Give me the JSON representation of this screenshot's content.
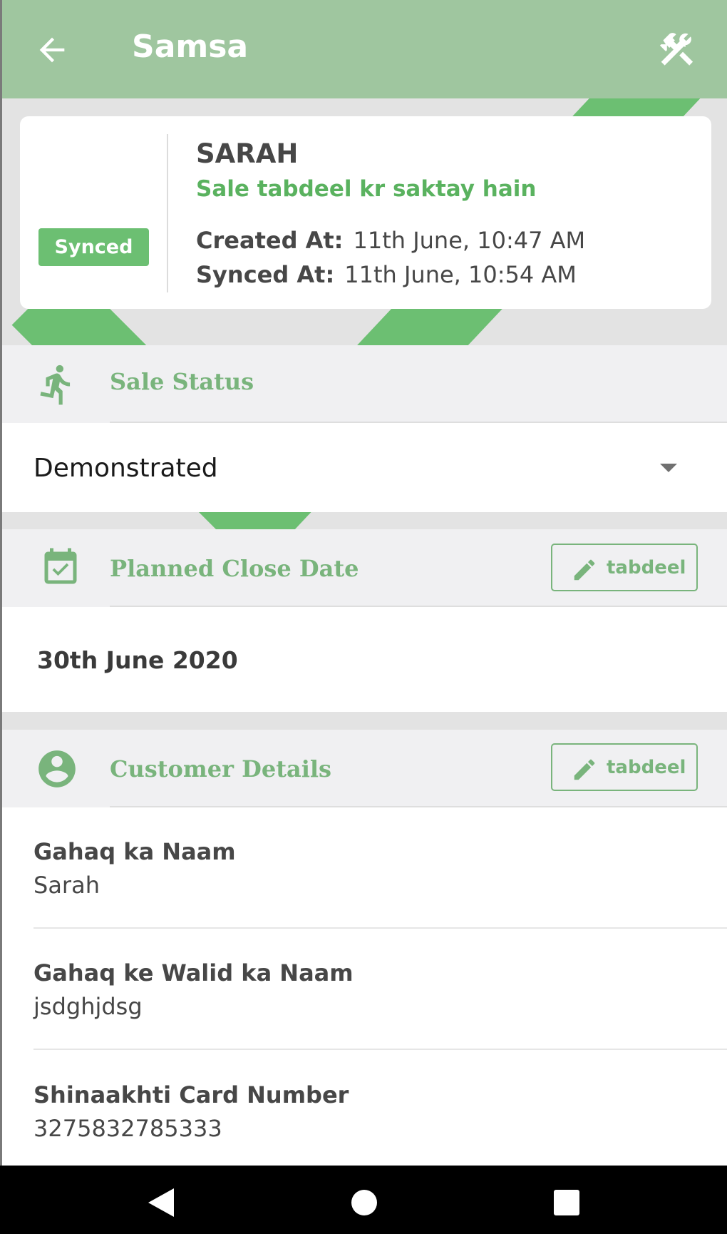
{
  "app_bar": {
    "title": "Samsa",
    "back_icon": "arrow-left-icon",
    "tools_icon": "tools-icon"
  },
  "status_card": {
    "badge": "Synced",
    "name": "SARAH",
    "subtitle": "Sale tabdeel kr saktay hain",
    "created_label": "Created At:",
    "created_value": "11th June, 10:47 AM",
    "synced_label": "Synced At:",
    "synced_value": "11th June, 10:54 AM"
  },
  "sale_status": {
    "title": "Sale Status",
    "icon": "running-person-icon",
    "selected": "Demonstrated"
  },
  "planned_close": {
    "title": "Planned Close Date",
    "icon": "calendar-check-icon",
    "edit_label": "tabdeel",
    "value": "30th June 2020"
  },
  "customer": {
    "title": "Customer Details",
    "icon": "account-circle-icon",
    "edit_label": "tabdeel",
    "fields": [
      {
        "label": "Gahaq ka Naam",
        "value": "Sarah"
      },
      {
        "label": "Gahaq ke Walid ka Naam",
        "value": "jsdghjdsg"
      },
      {
        "label": "Shinaakhti Card Number",
        "value": "3275832785333"
      }
    ]
  },
  "colors": {
    "app_bar": "#9fc69f",
    "accent_green": "#79b47c",
    "badge_green": "#6cbf72"
  },
  "nav": {
    "back": "nav-back-icon",
    "home": "nav-home-icon",
    "recents": "nav-recents-icon"
  }
}
